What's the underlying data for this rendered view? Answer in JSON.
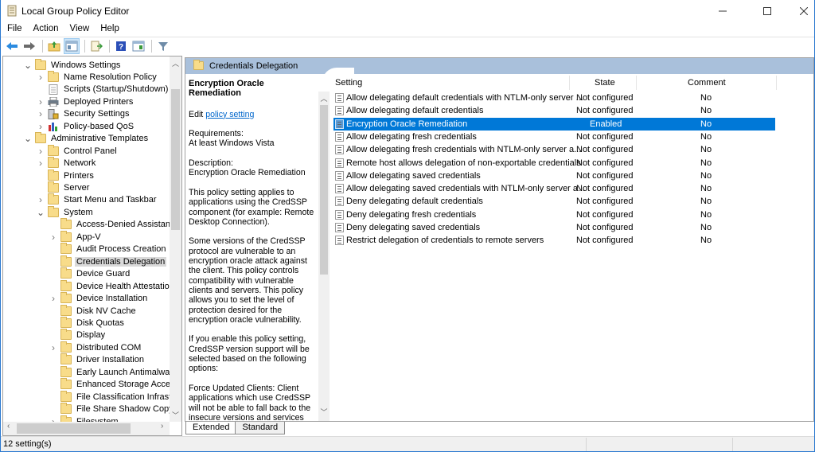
{
  "window": {
    "title": "Local Group Policy Editor",
    "controls": {
      "minimize": "—",
      "maximize": "☐",
      "close": "✕"
    }
  },
  "menu": [
    "File",
    "Action",
    "View",
    "Help"
  ],
  "toolbar": [
    {
      "name": "back-icon",
      "glyph": "🡄"
    },
    {
      "name": "forward-icon",
      "glyph": "🡆"
    },
    {
      "name": "up-folder-icon",
      "glyph": "📁"
    },
    {
      "name": "show-hide-console-tree-icon",
      "glyph": "▦"
    },
    {
      "name": "export-list-icon",
      "glyph": "📄"
    },
    {
      "name": "help-icon",
      "glyph": "?"
    },
    {
      "name": "show-hide-action-pane-icon",
      "glyph": "▦"
    },
    {
      "name": "filter-icon",
      "glyph": "▼"
    }
  ],
  "tree": [
    {
      "label": "Windows Settings",
      "level": 0,
      "expander": "expanded",
      "icon": "folder"
    },
    {
      "label": "Name Resolution Policy",
      "level": 1,
      "expander": "collapsed",
      "icon": "folder"
    },
    {
      "label": "Scripts (Startup/Shutdown)",
      "level": 1,
      "expander": "none",
      "icon": "script"
    },
    {
      "label": "Deployed Printers",
      "level": 1,
      "expander": "collapsed",
      "icon": "printer"
    },
    {
      "label": "Security Settings",
      "level": 1,
      "expander": "collapsed",
      "icon": "security"
    },
    {
      "label": "Policy-based QoS",
      "level": 1,
      "expander": "collapsed",
      "icon": "chart"
    },
    {
      "label": "Administrative Templates",
      "level": 0,
      "expander": "expanded",
      "icon": "folder"
    },
    {
      "label": "Control Panel",
      "level": 1,
      "expander": "collapsed",
      "icon": "folder"
    },
    {
      "label": "Network",
      "level": 1,
      "expander": "collapsed",
      "icon": "folder"
    },
    {
      "label": "Printers",
      "level": 1,
      "expander": "none",
      "icon": "folder"
    },
    {
      "label": "Server",
      "level": 1,
      "expander": "none",
      "icon": "folder"
    },
    {
      "label": "Start Menu and Taskbar",
      "level": 1,
      "expander": "collapsed",
      "icon": "folder"
    },
    {
      "label": "System",
      "level": 1,
      "expander": "expanded",
      "icon": "folder"
    },
    {
      "label": "Access-Denied Assistance",
      "level": 2,
      "expander": "none",
      "icon": "folder"
    },
    {
      "label": "App-V",
      "level": 2,
      "expander": "collapsed",
      "icon": "folder"
    },
    {
      "label": "Audit Process Creation",
      "level": 2,
      "expander": "none",
      "icon": "folder"
    },
    {
      "label": "Credentials Delegation",
      "level": 2,
      "expander": "none",
      "icon": "folder",
      "selected": true
    },
    {
      "label": "Device Guard",
      "level": 2,
      "expander": "none",
      "icon": "folder"
    },
    {
      "label": "Device Health Attestation S",
      "level": 2,
      "expander": "none",
      "icon": "folder"
    },
    {
      "label": "Device Installation",
      "level": 2,
      "expander": "collapsed",
      "icon": "folder"
    },
    {
      "label": "Disk NV Cache",
      "level": 2,
      "expander": "none",
      "icon": "folder"
    },
    {
      "label": "Disk Quotas",
      "level": 2,
      "expander": "none",
      "icon": "folder"
    },
    {
      "label": "Display",
      "level": 2,
      "expander": "none",
      "icon": "folder"
    },
    {
      "label": "Distributed COM",
      "level": 2,
      "expander": "collapsed",
      "icon": "folder"
    },
    {
      "label": "Driver Installation",
      "level": 2,
      "expander": "none",
      "icon": "folder"
    },
    {
      "label": "Early Launch Antimalware",
      "level": 2,
      "expander": "none",
      "icon": "folder"
    },
    {
      "label": "Enhanced Storage Access",
      "level": 2,
      "expander": "none",
      "icon": "folder"
    },
    {
      "label": "File Classification Infrastruc",
      "level": 2,
      "expander": "none",
      "icon": "folder"
    },
    {
      "label": "File Share Shadow Copy Prc",
      "level": 2,
      "expander": "none",
      "icon": "folder"
    },
    {
      "label": "Filesystem",
      "level": 2,
      "expander": "collapsed",
      "icon": "folder"
    }
  ],
  "right_pane": {
    "header": "Credentials Delegation",
    "description": {
      "title": "Encryption Oracle Remediation",
      "edit_prefix": "Edit ",
      "edit_link": "policy setting ",
      "requirements_label": "Requirements:",
      "requirements_value": "At least Windows Vista",
      "description_label": "Description:",
      "description_value": "Encryption Oracle Remediation",
      "para1": "This policy setting applies to applications using the CredSSP component (for example: Remote Desktop Connection).",
      "para2": "Some versions of the CredSSP protocol are vulnerable to an encryption oracle attack against the client.  This policy controls compatibility with vulnerable clients and servers.  This policy allows you to set the level of protection desired for the encryption oracle vulnerability.",
      "para3": "If you enable this policy setting, CredSSP version support will be selected based on the following options:",
      "para4": "Force Updated Clients: Client applications which use CredSSP will not be able to fall back to the insecure versions and services"
    },
    "columns": {
      "setting": "Setting",
      "state": "State",
      "comment": "Comment"
    },
    "settings": [
      {
        "name": "Allow delegating default credentials with NTLM-only server ...",
        "state": "Not configured",
        "comment": "No"
      },
      {
        "name": "Allow delegating default credentials",
        "state": "Not configured",
        "comment": "No"
      },
      {
        "name": "Encryption Oracle Remediation",
        "state": "Enabled",
        "comment": "No",
        "selected": true
      },
      {
        "name": "Allow delegating fresh credentials",
        "state": "Not configured",
        "comment": "No"
      },
      {
        "name": "Allow delegating fresh credentials with NTLM-only server a...",
        "state": "Not configured",
        "comment": "No"
      },
      {
        "name": "Remote host allows delegation of non-exportable credentials",
        "state": "Not configured",
        "comment": "No"
      },
      {
        "name": "Allow delegating saved credentials",
        "state": "Not configured",
        "comment": "No"
      },
      {
        "name": "Allow delegating saved credentials with NTLM-only server a...",
        "state": "Not configured",
        "comment": "No"
      },
      {
        "name": "Deny delegating default credentials",
        "state": "Not configured",
        "comment": "No"
      },
      {
        "name": "Deny delegating fresh credentials",
        "state": "Not configured",
        "comment": "No"
      },
      {
        "name": "Deny delegating saved credentials",
        "state": "Not configured",
        "comment": "No"
      },
      {
        "name": "Restrict delegation of credentials to remote servers",
        "state": "Not configured",
        "comment": "No"
      }
    ]
  },
  "tabs": [
    {
      "label": "Extended",
      "active": true
    },
    {
      "label": "Standard",
      "active": false
    }
  ],
  "status": "12 setting(s)",
  "colors": {
    "selection": "#0078d7",
    "pane_header": "#a9c0db",
    "link": "#0066cc",
    "tree_selection": "#d9d9d9"
  }
}
